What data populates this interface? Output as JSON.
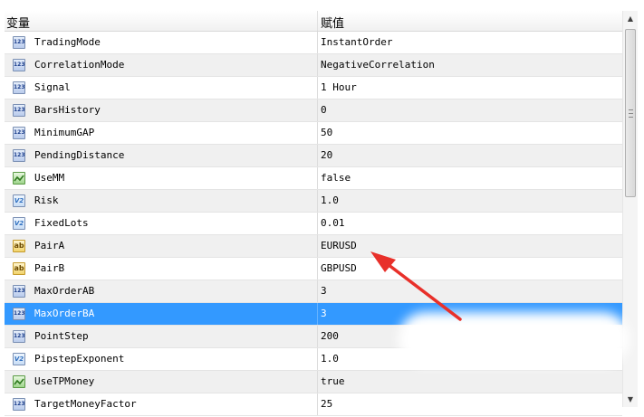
{
  "table": {
    "header": {
      "col_variable": "变量",
      "col_value": "赋值"
    },
    "rows": [
      {
        "type": "int",
        "icon": "int-type-icon",
        "name": "TradingMode",
        "value": "InstantOrder"
      },
      {
        "type": "int",
        "icon": "int-type-icon",
        "name": "CorrelationMode",
        "value": "NegativeCorrelation"
      },
      {
        "type": "int",
        "icon": "int-type-icon",
        "name": "Signal",
        "value": "1 Hour"
      },
      {
        "type": "int",
        "icon": "int-type-icon",
        "name": "BarsHistory",
        "value": "0"
      },
      {
        "type": "int",
        "icon": "int-type-icon",
        "name": "MinimumGAP",
        "value": "50"
      },
      {
        "type": "int",
        "icon": "int-type-icon",
        "name": "PendingDistance",
        "value": "20"
      },
      {
        "type": "bool",
        "icon": "bool-type-icon",
        "name": "UseMM",
        "value": "false"
      },
      {
        "type": "dbl",
        "icon": "double-type-icon",
        "name": "Risk",
        "value": "1.0"
      },
      {
        "type": "dbl",
        "icon": "double-type-icon",
        "name": "FixedLots",
        "value": "0.01"
      },
      {
        "type": "str",
        "icon": "string-type-icon",
        "name": "PairA",
        "value": "EURUSD"
      },
      {
        "type": "str",
        "icon": "string-type-icon",
        "name": "PairB",
        "value": "GBPUSD"
      },
      {
        "type": "int",
        "icon": "int-type-icon",
        "name": "MaxOrderAB",
        "value": "3"
      },
      {
        "type": "int",
        "icon": "int-type-icon",
        "name": "MaxOrderBA",
        "value": "3",
        "selected": true
      },
      {
        "type": "int",
        "icon": "int-type-icon",
        "name": "PointStep",
        "value": "200"
      },
      {
        "type": "dbl",
        "icon": "double-type-icon",
        "name": "PipstepExponent",
        "value": "1.0"
      },
      {
        "type": "bool",
        "icon": "bool-type-icon",
        "name": "UseTPMoney",
        "value": "true"
      },
      {
        "type": "int",
        "icon": "int-type-icon",
        "name": "TargetMoneyFactor",
        "value": "25"
      }
    ]
  },
  "icons": {
    "int_text": "123",
    "dbl_text": "V2",
    "str_text": "ab"
  },
  "colors": {
    "selected_row": "#3399ff",
    "alt_row": "#f0f0f0",
    "annotation_arrow": "#e8302a"
  },
  "scrollbar": {
    "up_icon": "scroll-up-arrow-icon",
    "down_icon": "scroll-down-arrow-icon"
  }
}
